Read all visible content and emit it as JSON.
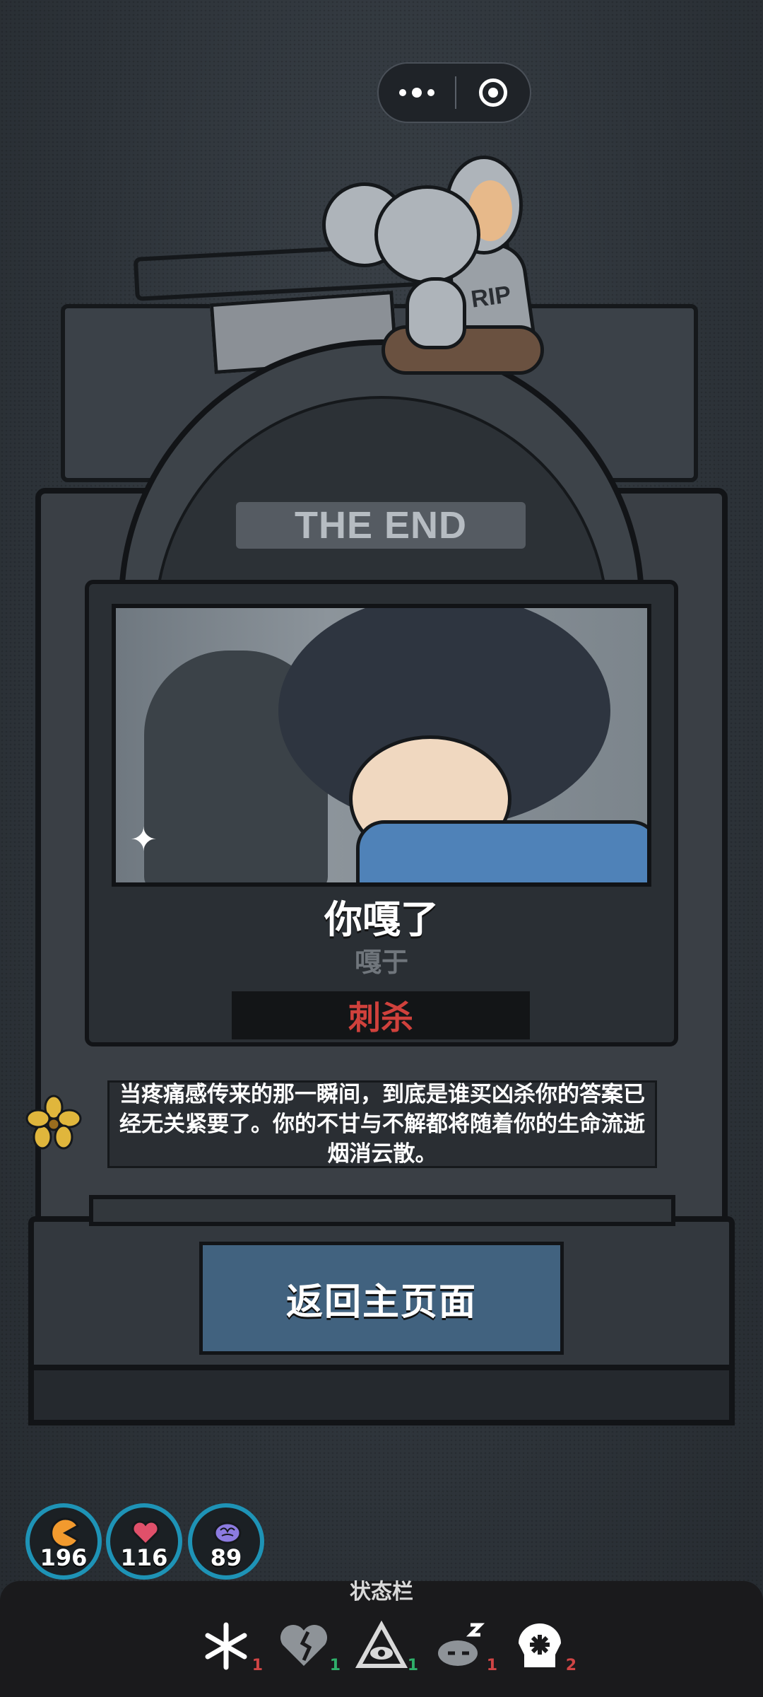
{
  "header": {
    "more_icon": "more-dots-icon",
    "close_icon": "target-close-icon"
  },
  "decor": {
    "rip_label": "RIP"
  },
  "tombstone": {
    "plate_title": "THE END",
    "death_title": "你嘎了",
    "death_sub": "嘎于",
    "cause": "刺杀",
    "description": "当疼痛感传来的那一瞬间，到底是谁买凶杀你的答案已经无关紧要了。你的不甘与不解都将随着你的生命流逝烟消云散。"
  },
  "actions": {
    "home_button": "返回主页面"
  },
  "stats": [
    {
      "name": "hunger",
      "icon": "pacman-food-icon",
      "value": "196",
      "color": "#f29a2e"
    },
    {
      "name": "health",
      "icon": "heart-icon",
      "value": "116",
      "color": "#e0506a"
    },
    {
      "name": "sanity",
      "icon": "brain-icon",
      "value": "89",
      "color": "#8c7be0"
    }
  ],
  "statusbar": {
    "title": "状态栏",
    "items": [
      {
        "icon": "snowflake-icon",
        "count": "1"
      },
      {
        "icon": "broken-heart-icon",
        "count": "1"
      },
      {
        "icon": "eye-triangle-icon",
        "count": "1"
      },
      {
        "icon": "sleep-icon",
        "count": "1"
      },
      {
        "icon": "skull-splat-icon",
        "count": "2"
      }
    ]
  },
  "colors": {
    "accent_blue": "#1e93b6",
    "cause_red": "#d0413c",
    "status_green": "#2faf6a",
    "status_red": "#d04545"
  }
}
